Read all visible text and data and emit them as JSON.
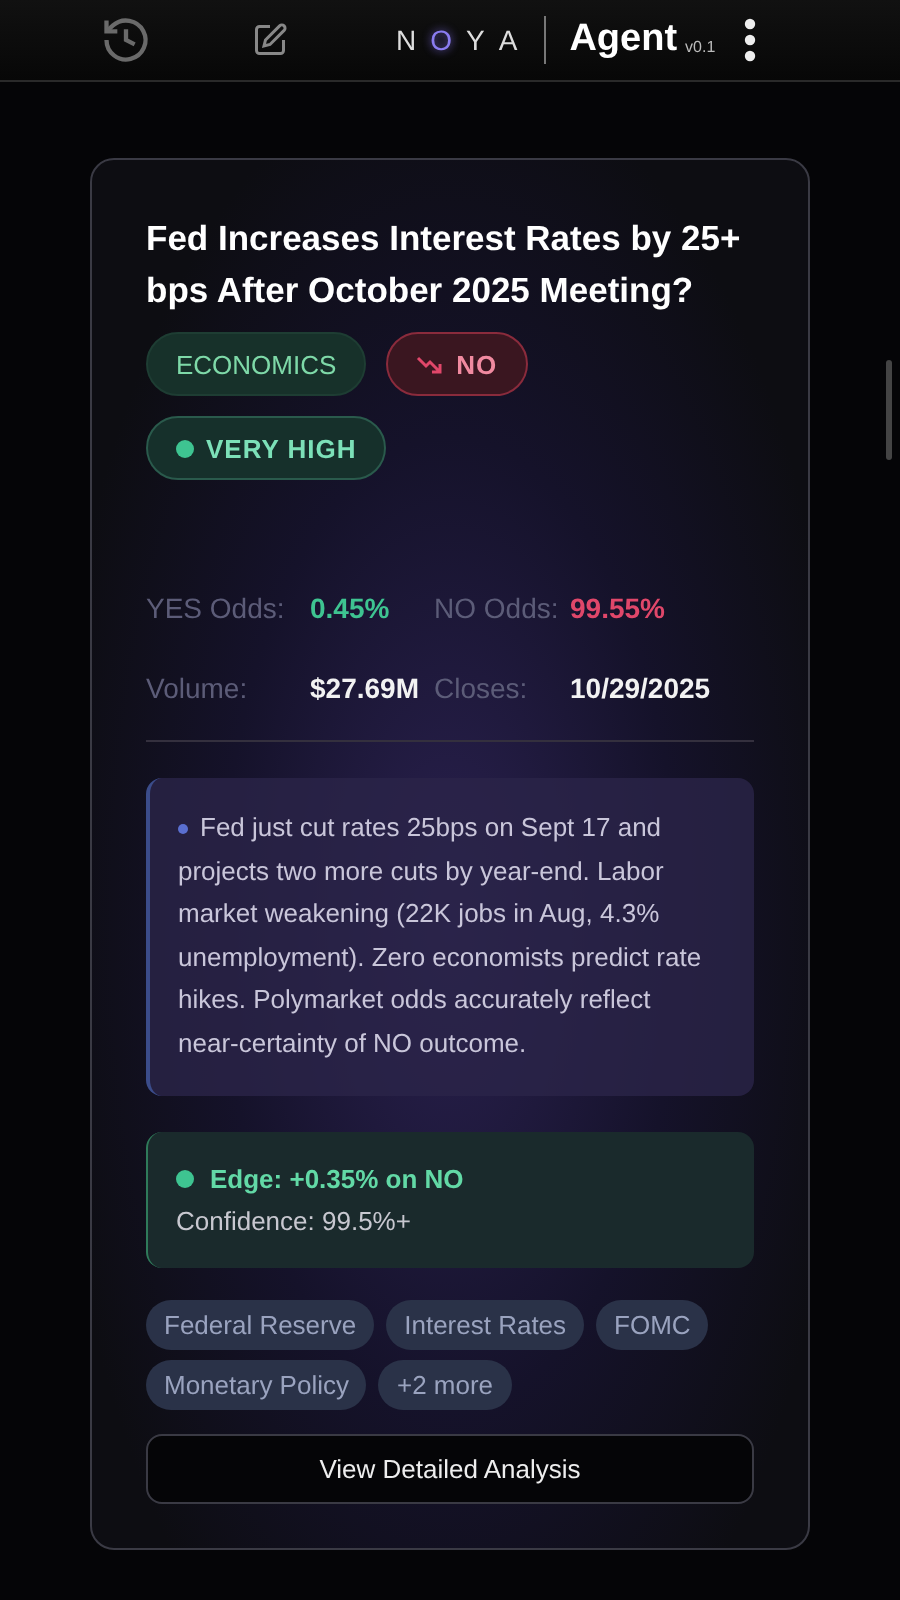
{
  "header": {
    "logo": [
      {
        "letter": "N",
        "accent": false
      },
      {
        "letter": "O",
        "accent": true
      },
      {
        "letter": "Y",
        "accent": false
      },
      {
        "letter": "A",
        "accent": false
      }
    ],
    "title": "Agent",
    "version": "v0.1"
  },
  "card": {
    "title": "Fed Increases Interest Rates by 25+ bps After October 2025 Meeting?",
    "badges": [
      {
        "kind": "category",
        "label": "ECONOMICS"
      },
      {
        "kind": "outcome",
        "label": "NO"
      },
      {
        "kind": "confidence",
        "label": "VERY HIGH"
      }
    ],
    "stats": [
      {
        "label": "YES Odds:",
        "value": "0.45%",
        "color": "#3ec491"
      },
      {
        "label": "NO Odds:",
        "value": "99.55%",
        "color": "#e0476a"
      },
      {
        "label": "Volume:",
        "value": "$27.69M",
        "color": "#f2f2f2"
      },
      {
        "label": "Closes:",
        "value": "10/29/2025",
        "color": "#f2f2f2"
      }
    ],
    "analysis": "Fed just cut rates 25bps on Sept 17 and projects two more cuts by year-end. Labor market weakening (22K jobs in Aug, 4.3% unemployment). Zero economists predict rate hikes. Polymarket odds accurately reflect near-certainty of NO outcome.",
    "edge": {
      "title": "Edge: +0.35% on NO",
      "confidence": "Confidence: 99.5%+"
    },
    "topics": [
      "Federal Reserve",
      "Interest Rates",
      "FOMC",
      "Monetary Policy",
      "+2 more"
    ],
    "button": "View Detailed Analysis"
  }
}
